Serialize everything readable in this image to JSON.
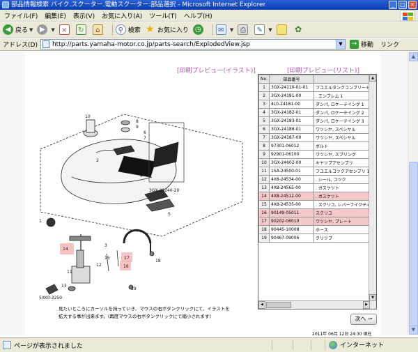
{
  "window": {
    "title": "部品情報検索 バイク.スクーター.電動スクーター:部品選択 - Microsoft Internet Explorer"
  },
  "menu": [
    "ファイル(F)",
    "編集(E)",
    "表示(V)",
    "お気に入り(A)",
    "ツール(T)",
    "ヘルプ(H)"
  ],
  "toolbar": {
    "back": "戻る",
    "search": "検索",
    "favorites": "お気に入り"
  },
  "address": {
    "label": "アドレス(D)",
    "url": "http://parts.yamaha-motor.co.jp/parts-search/ExplodedView.jsp",
    "go": "移動",
    "links": "リンク"
  },
  "preview": {
    "illustration": "[印刷プレビュー(イラスト)]",
    "list": "[印刷プレビュー(リスト)]"
  },
  "parts_table": {
    "headers": [
      "No.",
      "部品番号",
      ""
    ],
    "rows": [
      {
        "no": "1",
        "code": "3GX-24110-01-01",
        "name": "フユエルタンクコンプリート",
        "hl": false
      },
      {
        "no": "2",
        "code": "3GX-24181-00",
        "name": ". エンブレム 1",
        "hl": false
      },
      {
        "no": "3",
        "code": "4L0-24181-00",
        "name": "ダンパ, ロケーテイング 1",
        "hl": false
      },
      {
        "no": "4",
        "code": "3GX-24182-01",
        "name": "ダンパ, ロケーテイング 2",
        "hl": false
      },
      {
        "no": "5",
        "code": "3GX-24183-01",
        "name": "ダンパ, ロケーテイング 3",
        "hl": false
      },
      {
        "no": "6",
        "code": "3GX-24186-01",
        "name": "ワツシヤ, スペシヤル",
        "hl": false
      },
      {
        "no": "7",
        "code": "3GX-24187-00",
        "name": "ワツシヤ, スペシヤル",
        "hl": false
      },
      {
        "no": "8",
        "code": "97301-06012",
        "name": "ボルト",
        "hl": false
      },
      {
        "no": "9",
        "code": "92901-06100",
        "name": "ワツシヤ, スプリング",
        "hl": false
      },
      {
        "no": "10",
        "code": "3GX-24602-00",
        "name": "キヤツプアセンブリ",
        "hl": false
      },
      {
        "no": "11",
        "code": "1SA-24500-01",
        "name": "フユエルコツクアセンブリ 1",
        "hl": false
      },
      {
        "no": "12",
        "code": "4X8-24534-00",
        "name": ". シール, コツク",
        "hl": false
      },
      {
        "no": "13",
        "code": "4X8-24565-00",
        "name": ". ガスケツト",
        "hl": false
      },
      {
        "no": "14",
        "code": "4X8-24512-00",
        "name": ". ガスケツト",
        "hl": true
      },
      {
        "no": "15",
        "code": "4X8-24535-00",
        "name": ". スクリユ, レバーフイクティ",
        "hl": false
      },
      {
        "no": "16",
        "code": "90149-05011",
        "name": "スクリユ",
        "hl": true
      },
      {
        "no": "17",
        "code": "90202-06010",
        "name": "ワツシヤ, プレート",
        "hl": true
      },
      {
        "no": "18",
        "code": "90445-10008",
        "name": "ホース",
        "hl": false
      },
      {
        "no": "19",
        "code": "90467-09006",
        "name": "クリツプ",
        "hl": false
      }
    ]
  },
  "diagram": {
    "callouts": [
      "1",
      "2",
      "3",
      "4",
      "5",
      "6",
      "7",
      "8",
      "9",
      "10",
      "11",
      "12",
      "13",
      "14",
      "15",
      "16",
      "17",
      "18",
      "19"
    ],
    "code_label": "3GX-24240-20",
    "ref_label": "5XK0-3250"
  },
  "hint": {
    "line1": "見たいところにカーソルを持っていき、マウスの右ボタンクリックにて、イラストを",
    "line2": "拡大する事が出来ます。(再度マウスの右ボタンクリックにて縮小されます)"
  },
  "next_button": "次へ",
  "footer_note": "2011年 06月 12日 24:30 現在",
  "status": {
    "text": "ページが表示されました",
    "zone": "インターネット"
  }
}
